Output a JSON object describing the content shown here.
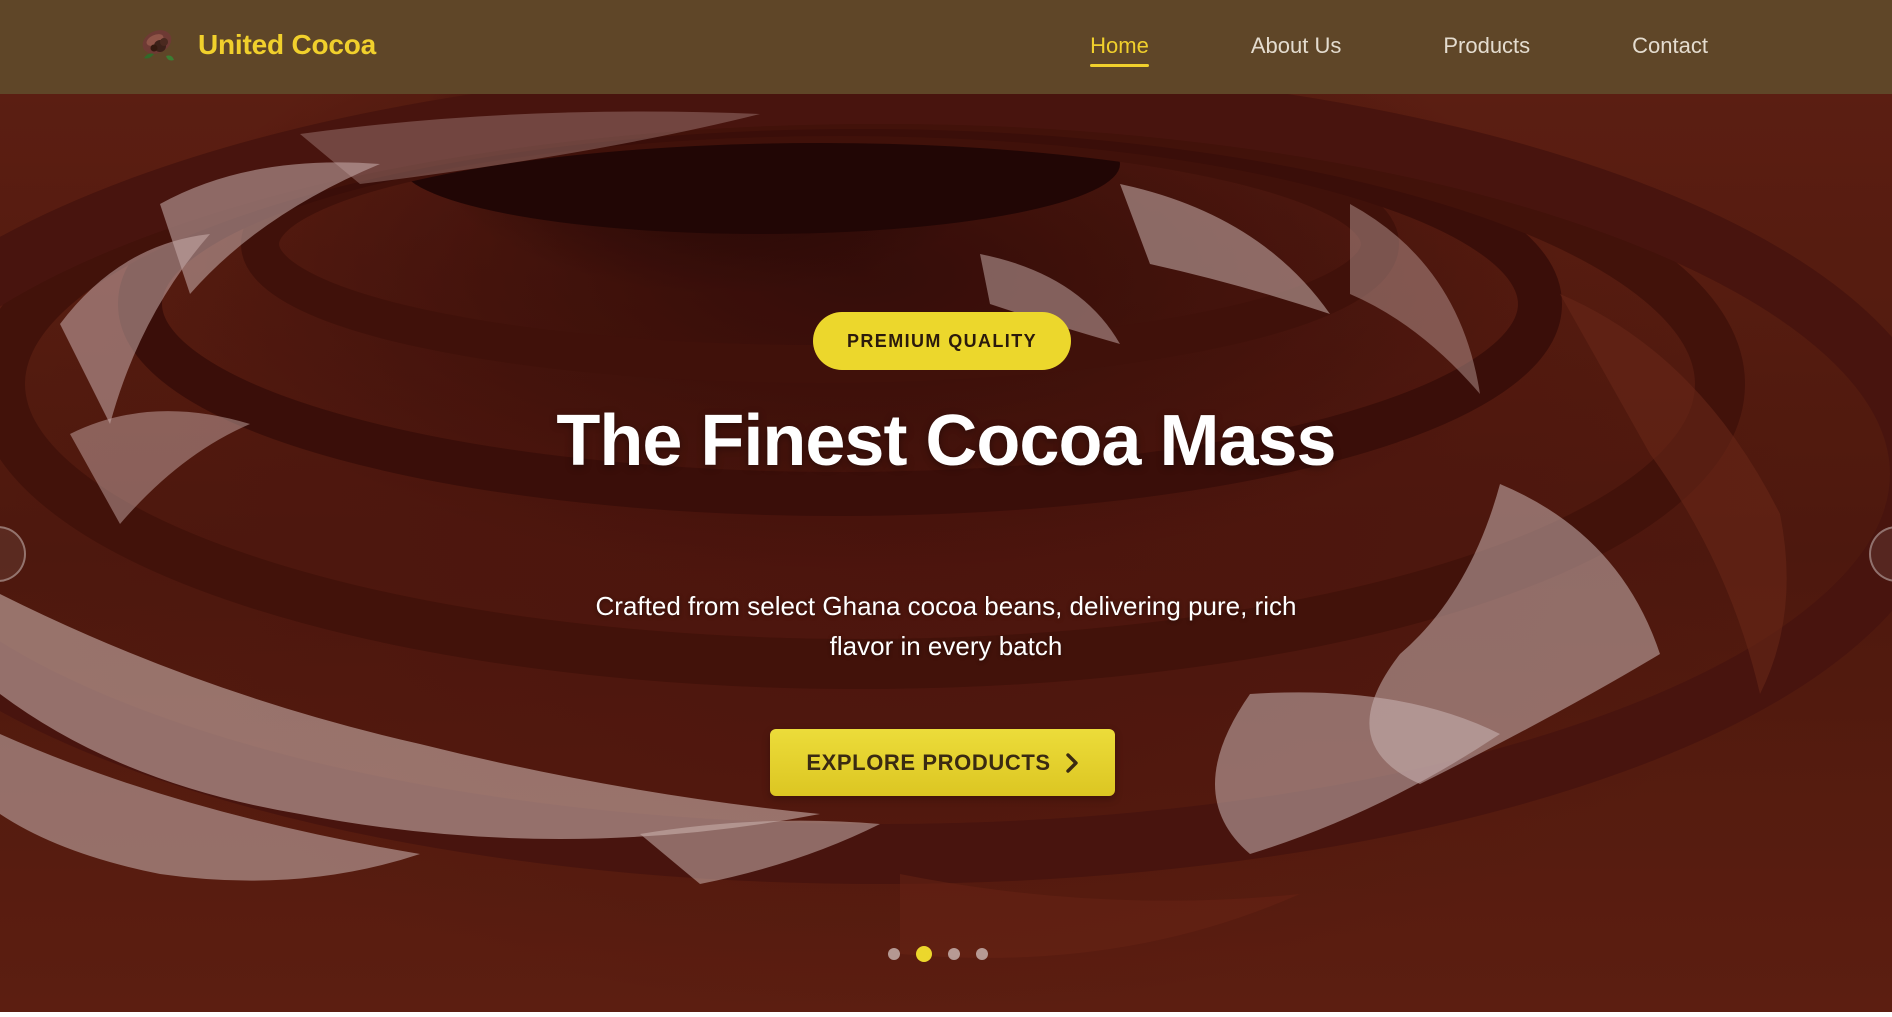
{
  "brand": {
    "name": "United Cocoa",
    "logo_icon": "cocoa-pod-icon"
  },
  "nav": {
    "items": [
      {
        "label": "Home",
        "active": true
      },
      {
        "label": "About Us",
        "active": false
      },
      {
        "label": "Products",
        "active": false
      },
      {
        "label": "Contact",
        "active": false
      }
    ]
  },
  "hero": {
    "badge": "PREMIUM QUALITY",
    "title": "The Finest Cocoa Mass",
    "subtitle": "Crafted from select Ghana cocoa beans, delivering pure, rich flavor in every batch",
    "cta_label": "EXPLORE PRODUCTS",
    "cta_icon": "chevron-right-icon",
    "prev_icon": "chevron-left-icon",
    "next_icon": "chevron-right-icon"
  },
  "carousel": {
    "slide_count": 4,
    "active_index": 1
  },
  "colors": {
    "header_bg": "#5f4628",
    "accent": "#f1d02c",
    "nav_text": "#e4dccf",
    "chocolate": "#5a1d10"
  }
}
